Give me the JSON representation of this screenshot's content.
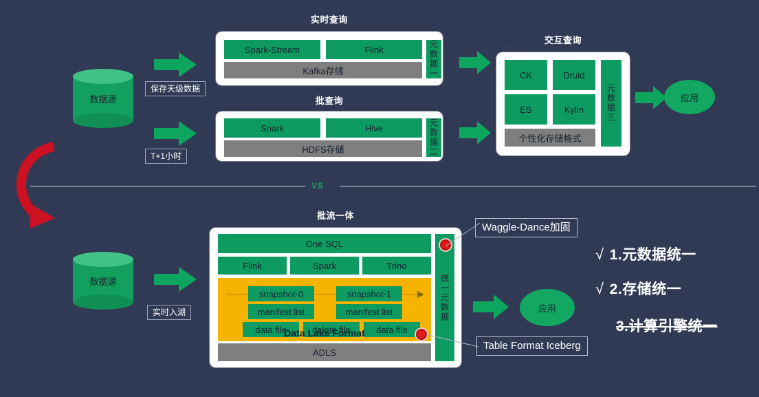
{
  "background_color": "#303a54",
  "palette": {
    "green": "#0d9b61",
    "gray": "#7f7f7f",
    "yellow": "#f6b300",
    "panel_white": "#ffffff",
    "red_marker": "#e01b1b",
    "red_arrow": "#cc1122",
    "vs_green": "#1da06a"
  },
  "divider": {
    "vs_label": "VS"
  },
  "top": {
    "source": {
      "label": "数据源"
    },
    "flows": [
      {
        "label": "保存天级数据"
      },
      {
        "label": "T+1小时"
      }
    ],
    "sections": [
      {
        "title": "实时查询",
        "engines": [
          "Spark-Stream",
          "Flink"
        ],
        "storage": "Kafka存储",
        "metadata": "元数据一"
      },
      {
        "title": "批查询",
        "engines": [
          "Spark",
          "Hive"
        ],
        "storage": "HDFS存储",
        "metadata": "元数据二"
      }
    ],
    "interactive": {
      "title": "交互查询",
      "engines": [
        "CK",
        "Druid",
        "ES",
        "Kylin"
      ],
      "storage": "个性化存储格式",
      "metadata": "元数据三"
    },
    "app": {
      "label": "应用"
    }
  },
  "bottom": {
    "title": "批流一体",
    "source": {
      "label": "数据源"
    },
    "flow": {
      "label": "实时入湖"
    },
    "one_sql": "One SQL",
    "engines": [
      "Flink",
      "Spark",
      "Trino"
    ],
    "lake": {
      "caption": "Data Lake Format",
      "snapshots": [
        "snapshot-0",
        "snapshot-1"
      ],
      "manifests": [
        "manifest list",
        "manifest list"
      ],
      "files": [
        "data file",
        "delete file",
        "data file"
      ]
    },
    "storage": "ADLS",
    "metadata": "统一元数据",
    "app": {
      "label": "应用"
    },
    "callouts": [
      {
        "text": "Waggle-Dance加固"
      },
      {
        "text": "Table Format Iceberg"
      }
    ]
  },
  "benefits": [
    {
      "tick": "√",
      "text": "1.元数据统一",
      "struck": false
    },
    {
      "tick": "√",
      "text": "2.存储统一",
      "struck": false
    },
    {
      "tick": "",
      "text": "3.计算引擎统一",
      "struck": true
    }
  ]
}
